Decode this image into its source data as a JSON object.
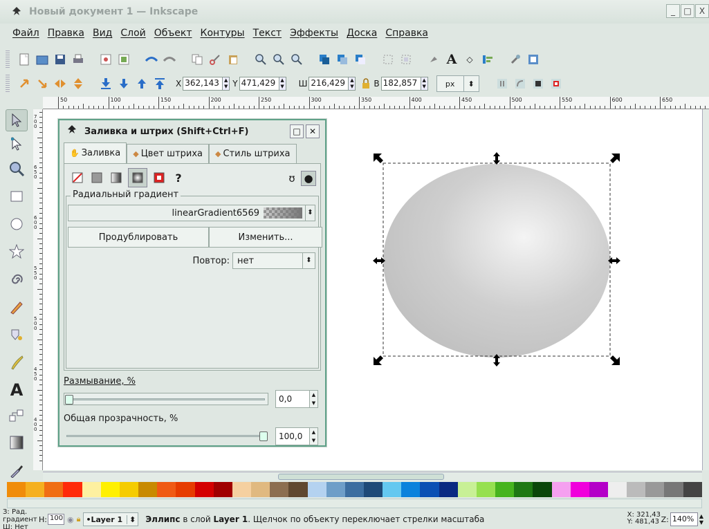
{
  "window": {
    "title": "Новый документ 1 — Inkscape",
    "min": "_",
    "max": "□",
    "close": "X"
  },
  "menu": [
    "Файл",
    "Правка",
    "Вид",
    "Слой",
    "Объект",
    "Контуры",
    "Текст",
    "Эффекты",
    "Доска",
    "Справка"
  ],
  "coords_toolbar": {
    "x_label": "X",
    "x_value": "362,143",
    "y_label": "Y",
    "y_value": "471,429",
    "w_label": "Ш",
    "w_value": "216,429",
    "h_label": "В",
    "h_value": "182,857",
    "units": "px"
  },
  "ruler": [
    "50",
    "100",
    "150",
    "200",
    "250",
    "300",
    "350",
    "400",
    "450",
    "500",
    "550",
    "600",
    "650"
  ],
  "vruler": [
    "7 0 0",
    "6 5 0",
    "6 0 0",
    "5 5 0",
    "5 0 0",
    "4 5 0",
    "4 0 0"
  ],
  "dialog": {
    "title": "Заливка и штрих (Shift+Ctrl+F)",
    "tabs": [
      "Заливка",
      "Цвет штриха",
      "Стиль штриха"
    ],
    "gradient_section": "Радиальный градиент",
    "gradient_name": "linearGradient6569",
    "duplicate_button": "Продублировать",
    "edit_button": "Изменить...",
    "repeat_label": "Повтор:",
    "repeat_value": "нет",
    "blur_label": "Размывание, %",
    "blur_value": "0,0",
    "blur_level": 0.0,
    "opacity_label": "Общая прозрачность, %",
    "opacity_value": "100,0",
    "opacity_level": 1.0
  },
  "palette_colors": [
    "#f08c0a",
    "#f5b020",
    "#f06e14",
    "#ff2a0a",
    "#fdf0a0",
    "#fff000",
    "#f5cc00",
    "#c88a00",
    "#f05a14",
    "#e63c00",
    "#d40000",
    "#a00000",
    "#f5d0a0",
    "#e0b980",
    "#8c6e50",
    "#604830",
    "#b4d2f0",
    "#6e9ec8",
    "#3c6ea0",
    "#1e4a78",
    "#64c8f0",
    "#0a82dc",
    "#0a50b4",
    "#0a2a82",
    "#c8f096",
    "#96e050",
    "#46b41e",
    "#1e7814",
    "#0a460a",
    "#f5a0f0",
    "#f000dc",
    "#b400c8",
    "#eeeeee",
    "#bbbbbb",
    "#999999",
    "#777777",
    "#444444"
  ],
  "status": {
    "fill_label": "З:",
    "fill_value": "Рад. градиент",
    "stroke_label": "Ш:",
    "stroke_value": "Нет",
    "h_label": "Н:",
    "h_value": "100",
    "layer": "•Layer 1",
    "message_obj": "Эллипс",
    "message_mid": " в слой ",
    "message_layer": "Layer 1",
    "message_rest": ". Щелчок по объекту переключает стрелки масштаба",
    "x": "X: 321,43",
    "y": "Y: 481,43",
    "z_label": "Z:",
    "zoom": "140%"
  },
  "colors": {
    "selection_accent": "#5fa188"
  }
}
